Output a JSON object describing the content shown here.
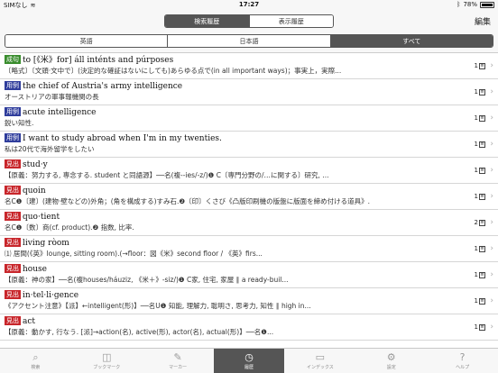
{
  "status": {
    "carrier": "SIMなし",
    "time": "17:27",
    "battery": "78%"
  },
  "header": {
    "segments": [
      {
        "label": "検索履歴",
        "active": true
      },
      {
        "label": "表示履歴",
        "active": false
      }
    ],
    "edit_label": "編集"
  },
  "filter": {
    "options": [
      {
        "label": "英語",
        "active": false
      },
      {
        "label": "日本語",
        "active": false
      },
      {
        "label": "すべて",
        "active": true
      }
    ]
  },
  "rows": [
    {
      "tag": "成句",
      "tag_color": "#3a8d2e",
      "title": "to [《米》for] áll inténts and púrposes",
      "desc": "〔略式〕〔文頭‧文中で〕(決定的な確証はないにしても)あらゆる点で(in all important ways)；事実上，実際...",
      "count": "1"
    },
    {
      "tag": "用例",
      "tag_color": "#2f3d9c",
      "title": "the chief of Austria's army intelligence",
      "desc": "オーストリアの軍事報機関の長",
      "count": "1"
    },
    {
      "tag": "用例",
      "tag_color": "#2f3d9c",
      "title": "acute intelligence",
      "desc": "鋭い知性.",
      "count": "1"
    },
    {
      "tag": "用例",
      "tag_color": "#2f3d9c",
      "title": "I want to study abroad when I'm in my twenties.",
      "desc": "私は20代で海外留学をしたい",
      "count": "1"
    },
    {
      "tag": "見出",
      "tag_color": "#c8262b",
      "title": "stud·y",
      "desc": "【原義：努力する, 専念する. student と同語源】──名(複--ies/-z/)❶ C〔専門分野の/…に関する〕研究, ...",
      "count": "1"
    },
    {
      "tag": "見出",
      "tag_color": "#c8262b",
      "title": "quoin",
      "desc": "名C❶〔建〕(建物‧壁などの)外角；(角を構成する)すみ石.❷〔印〕くさび《凸版印刷機の版盤に版面を締め付ける道具》.",
      "count": "1"
    },
    {
      "tag": "見出",
      "tag_color": "#c8262b",
      "title": "quo·tient",
      "desc": "名C❶〔数〕商(cf. product).❷ 指数, 比率.",
      "count": "2"
    },
    {
      "tag": "見出",
      "tag_color": "#c8262b",
      "title": "living ròom",
      "desc": "⑴ 居間(《英》lounge, sitting room).(→floor：図《米》second floor / 《英》firs...",
      "count": "1"
    },
    {
      "tag": "見出",
      "tag_color": "#c8262b",
      "title": "house",
      "desc": "【原義：神の家】──名(複houses/háuziz, 《米＋》-siz/)❶ C家, 住宅, 家屋 ∥ a ready-buil...",
      "count": "1"
    },
    {
      "tag": "見出",
      "tag_color": "#c8262b",
      "title": "in·tel·li·gence",
      "desc": "《アクセント注意》【派】←intelligent(形)】──名U❶ 知能, 理解力, 聡明さ, 思考力, 知性 ∥ high in...",
      "count": "1"
    },
    {
      "tag": "見出",
      "tag_color": "#c8262b",
      "title": "act",
      "desc": "【原義：動かす, 行なう. [派]→action(名), active(形), actor(名), actual(形)】──名❶...",
      "count": "1"
    }
  ],
  "count_icon": "list-icon",
  "tabs": [
    {
      "label": "検索",
      "icon": "search-icon",
      "glyph": "⌕",
      "active": false
    },
    {
      "label": "ブックマーク",
      "icon": "book-icon",
      "glyph": "◫",
      "active": false
    },
    {
      "label": "マーカー",
      "icon": "pen-icon",
      "glyph": "✎",
      "active": false
    },
    {
      "label": "履歴",
      "icon": "clock-icon",
      "glyph": "◷",
      "active": true
    },
    {
      "label": "インデックス",
      "icon": "index-icon",
      "glyph": "▭",
      "active": false
    },
    {
      "label": "設定",
      "icon": "gear-icon",
      "glyph": "⚙",
      "active": false
    },
    {
      "label": "ヘルプ",
      "icon": "help-icon",
      "glyph": "?",
      "active": false
    }
  ]
}
